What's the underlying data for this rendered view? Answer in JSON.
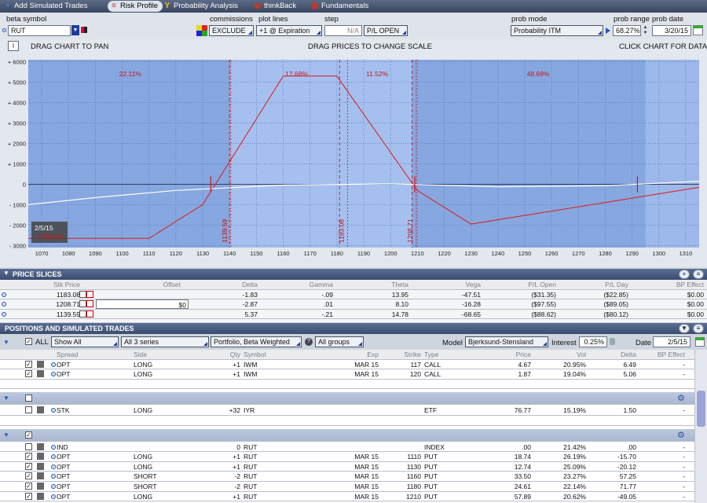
{
  "topbar": {
    "items": [
      {
        "label": "Add Simulated Trades",
        "icon": "plus-icon",
        "glyph": "+",
        "color": "#3c7cf0"
      },
      {
        "label": "Risk Profile",
        "icon": "risk-profile-icon",
        "glyph": "≡",
        "color": "#c0392b"
      },
      {
        "label": "Probability Analysis",
        "icon": "probability-icon",
        "glyph": "Y",
        "color": "#f1c40f"
      },
      {
        "label": "thinkBack",
        "icon": "thinkback-icon",
        "glyph": "◉",
        "color": "#c0392b"
      },
      {
        "label": "Fundamentals",
        "icon": "fundamentals-icon",
        "glyph": "▦",
        "color": "#c0392b"
      }
    ],
    "active": "Risk Profile"
  },
  "controls": {
    "beta_symbol_label": "beta symbol",
    "beta_symbol_value": "RUT",
    "commissions_label": "commissions",
    "commissions_value": "EXCLUDE",
    "plot_lines_label": "plot lines",
    "plot_lines_value": "+1 @ Expiration",
    "step_label": "step",
    "step_value": "N/A",
    "step_mode": "P/L OPEN",
    "prob_mode_label": "prob mode",
    "prob_mode_value": "Probability ITM",
    "prob_range_label": "prob range",
    "prob_range_value": "68.27%",
    "prob_date_label": "prob date",
    "prob_date_value": "3/20/15"
  },
  "chart_head": {
    "pan": "DRAG CHART TO PAN",
    "scale": "DRAG PRICES TO CHANGE SCALE",
    "data": "CLICK CHART FOR DATA"
  },
  "chart_data": {
    "type": "line",
    "xlim": [
      1065,
      1315
    ],
    "ylim": [
      -3100,
      6100
    ],
    "x_ticks": [
      1070,
      1080,
      1090,
      1100,
      1110,
      1120,
      1130,
      1140,
      1150,
      1160,
      1170,
      1180,
      1190,
      1200,
      1210,
      1220,
      1230,
      1240,
      1250,
      1260,
      1270,
      1280,
      1290,
      1300,
      1310
    ],
    "y_ticks": [
      {
        "v": 6000,
        "t": "+ 6000"
      },
      {
        "v": 5000,
        "t": "+ 5000"
      },
      {
        "v": 4000,
        "t": "+ 4000"
      },
      {
        "v": 3000,
        "t": "+ 3000"
      },
      {
        "v": 2000,
        "t": "+ 2000"
      },
      {
        "v": 1000,
        "t": "+ 1000"
      },
      {
        "v": 0,
        "t": "0"
      },
      {
        "v": -1000,
        "t": "- 1000"
      },
      {
        "v": -2000,
        "t": "- 2000"
      },
      {
        "v": -3000,
        "t": "- 3000"
      }
    ],
    "series": [
      {
        "color": "#e01818",
        "points": [
          [
            1065,
            -2650
          ],
          [
            1110,
            -2650
          ],
          [
            1130,
            -1000
          ],
          [
            1160,
            5300
          ],
          [
            1180,
            5300
          ],
          [
            1210,
            -300
          ],
          [
            1230,
            -1950
          ],
          [
            1315,
            -150
          ]
        ]
      },
      {
        "color": "#ffffff",
        "points": [
          [
            1065,
            -1000
          ],
          [
            1090,
            -650
          ],
          [
            1120,
            -300
          ],
          [
            1160,
            -40
          ],
          [
            1200,
            20
          ],
          [
            1240,
            -120
          ],
          [
            1280,
            -70
          ],
          [
            1315,
            150
          ]
        ]
      }
    ],
    "slices": [
      {
        "x": 1139.59,
        "label": "1139.59"
      },
      {
        "x": 1183.08,
        "label": "1183.08"
      },
      {
        "x": 1208.71,
        "label": "1208.71"
      }
    ],
    "prob_lines": [
      {
        "x": 1140
      },
      {
        "x": 1181
      },
      {
        "x": 1208
      }
    ],
    "prob_labels": [
      {
        "x": 1103,
        "text": "22.11%"
      },
      {
        "x": 1165,
        "text": "17.68%"
      },
      {
        "x": 1195,
        "text": "11.52%"
      },
      {
        "x": 1255,
        "text": "48.69%"
      }
    ],
    "date_tag": "2/5/15",
    "date_tag2": "-2,650.53"
  },
  "price_slices": {
    "title": "PRICE SLICES",
    "headers": [
      "Stk Price",
      "Offset",
      "Delta",
      "Gamma",
      "Theta",
      "Vega",
      "P/L Open",
      "P/L Day",
      "BP Effect"
    ],
    "rows": [
      [
        "1183.08",
        "",
        "-1.83",
        "-.09",
        "13.95",
        "-47.51",
        "($31.35)",
        "($22.85)",
        "$0.00"
      ],
      [
        "1208.71",
        "$0",
        "-2.87",
        ".01",
        "8.10",
        "-16.28",
        "($97.55)",
        "($89.05)",
        "$0.00"
      ],
      [
        "1139.59",
        "",
        "5.37",
        "-.21",
        "14.78",
        "-68.65",
        "($88.62)",
        "($80.12)",
        "$0.00"
      ]
    ]
  },
  "positions": {
    "title": "POSITIONS AND SIMULATED TRADES",
    "all_label": "ALL",
    "filter1": "Show All",
    "filter2": "All 3 series",
    "filter3": "Portfolio, Beta Weighted",
    "filter4": "All groups",
    "model_label": "Model",
    "model_value": "Bjerksund-Stensland",
    "interest_label": "Interest",
    "interest_value": "0.25%",
    "date_label": "Date",
    "date_value": "2/5/15",
    "headers": [
      "Spread",
      "Side",
      "Qty",
      "Symbol",
      "Exp",
      "Strike",
      "Type",
      "Price",
      "Vol",
      "Delta",
      "BP Effect"
    ],
    "iwm": [
      [
        "OPT",
        "LONG",
        "+1",
        "IWM",
        "MAR 15",
        "117",
        "CALL",
        "4.67",
        "20.95%",
        "6.49",
        "-"
      ],
      [
        "OPT",
        "LONG",
        "+1",
        "IWM",
        "MAR 15",
        "120",
        "CALL",
        "1.87",
        "19.04%",
        "5.06",
        "-"
      ]
    ],
    "iwm_total": "$0.00",
    "iyr_label": "IYR",
    "iyr": [
      [
        "STK",
        "LONG",
        "+32",
        "IYR",
        "",
        "",
        "ETF",
        "76.77",
        "15.19%",
        "1.50",
        "-"
      ]
    ],
    "iyr_total": "$0.00",
    "rut_label": "RUT",
    "rut": [
      [
        "IND",
        "",
        "0",
        "RUT",
        "",
        "",
        "INDEX",
        ".00",
        "21.42%",
        ".00",
        "-"
      ],
      [
        "OPT",
        "LONG",
        "+1",
        "RUT",
        "MAR 15",
        "1110",
        "PUT",
        "18.74",
        "26.19%",
        "-15.70",
        "-"
      ],
      [
        "OPT",
        "LONG",
        "+1",
        "RUT",
        "MAR 15",
        "1130",
        "PUT",
        "12.74",
        "25.09%",
        "-20.12",
        "-"
      ],
      [
        "OPT",
        "SHORT",
        "-2",
        "RUT",
        "MAR 15",
        "1160",
        "PUT",
        "33.50",
        "23.27%",
        "57.25",
        "-"
      ],
      [
        "OPT",
        "SHORT",
        "-2",
        "RUT",
        "MAR 15",
        "1180",
        "PUT",
        "24.61",
        "22.14%",
        "71.77",
        "-"
      ],
      [
        "OPT",
        "LONG",
        "+1",
        "RUT",
        "MAR 15",
        "1210",
        "PUT",
        "57.89",
        "20.62%",
        "-49.05",
        "-"
      ]
    ]
  }
}
